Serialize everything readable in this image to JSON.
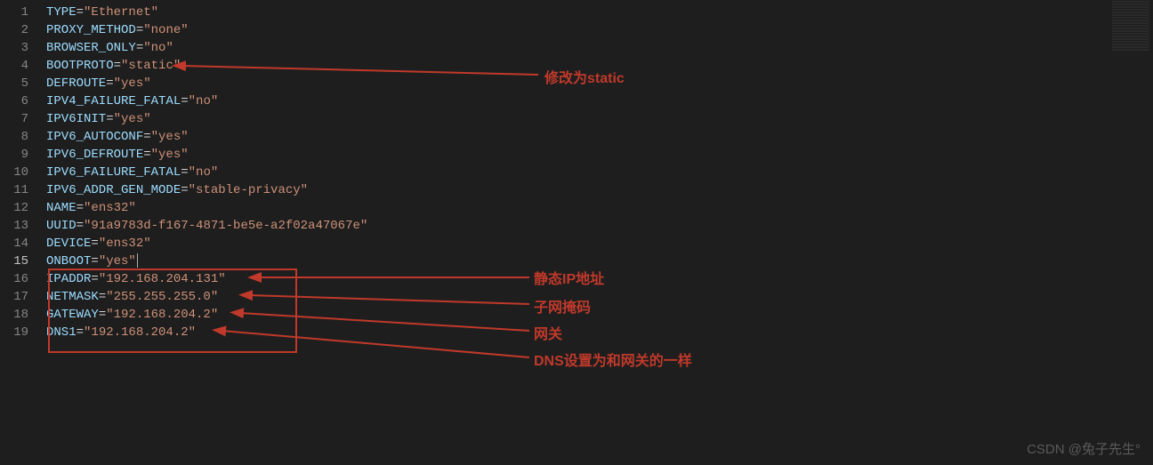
{
  "lines": [
    {
      "n": 1,
      "key": "TYPE",
      "val": "\"Ethernet\""
    },
    {
      "n": 2,
      "key": "PROXY_METHOD",
      "val": "\"none\""
    },
    {
      "n": 3,
      "key": "BROWSER_ONLY",
      "val": "\"no\""
    },
    {
      "n": 4,
      "key": "BOOTPROTO",
      "val": "\"static\""
    },
    {
      "n": 5,
      "key": "DEFROUTE",
      "val": "\"yes\""
    },
    {
      "n": 6,
      "key": "IPV4_FAILURE_FATAL",
      "val": "\"no\""
    },
    {
      "n": 7,
      "key": "IPV6INIT",
      "val": "\"yes\""
    },
    {
      "n": 8,
      "key": "IPV6_AUTOCONF",
      "val": "\"yes\""
    },
    {
      "n": 9,
      "key": "IPV6_DEFROUTE",
      "val": "\"yes\""
    },
    {
      "n": 10,
      "key": "IPV6_FAILURE_FATAL",
      "val": "\"no\""
    },
    {
      "n": 11,
      "key": "IPV6_ADDR_GEN_MODE",
      "val": "\"stable-privacy\""
    },
    {
      "n": 12,
      "key": "NAME",
      "val": "\"ens32\""
    },
    {
      "n": 13,
      "key": "UUID",
      "val": "\"91a9783d-f167-4871-be5e-a2f02a47067e\""
    },
    {
      "n": 14,
      "key": "DEVICE",
      "val": "\"ens32\""
    },
    {
      "n": 15,
      "key": "ONBOOT",
      "val": "\"yes\"",
      "active": true,
      "cursor": true
    },
    {
      "n": 16,
      "key": "IPADDR",
      "val": "\"192.168.204.131\""
    },
    {
      "n": 17,
      "key": "NETMASK",
      "val": "\"255.255.255.0\""
    },
    {
      "n": 18,
      "key": "GATEWAY",
      "val": "\"192.168.204.2\""
    },
    {
      "n": 19,
      "key": "DNS1",
      "val": "\"192.168.204.2\""
    }
  ],
  "annotations": {
    "modify_static": "修改为static",
    "static_ip": "静态IP地址",
    "netmask": "子网掩码",
    "gateway": "网关",
    "dns": "DNS设置为和网关的一样"
  },
  "watermark": "CSDN @兔子先生°"
}
